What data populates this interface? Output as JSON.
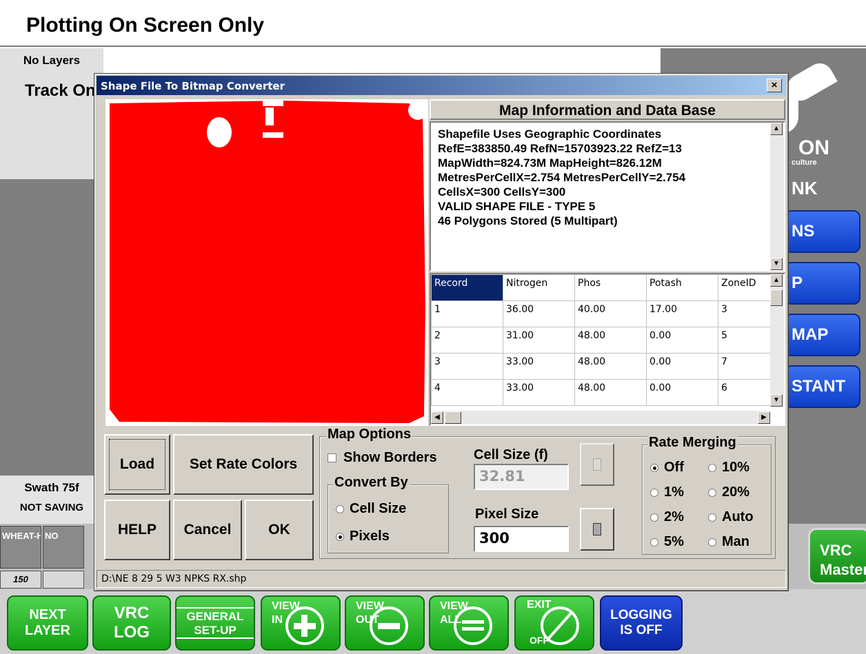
{
  "app": {
    "title": "Plotting On Screen Only",
    "left_panel": {
      "layers": "No Layers",
      "mode": "Track Only"
    },
    "swath": {
      "label": "Swath 75f",
      "saving": "NOT SAVING"
    },
    "logo": {
      "text1": "ON",
      "text2": "culture",
      "text3": "NK"
    },
    "side_buttons": [
      "NS",
      "P",
      "MAP",
      "STANT"
    ],
    "lanes": [
      {
        "label": "WHEAT-HR",
        "value": "150"
      },
      {
        "label": "NO",
        "value": ""
      }
    ],
    "vrc_master": {
      "line1": "VRC",
      "line2": "Master"
    }
  },
  "toolbar": {
    "next_layer": {
      "l1": "NEXT",
      "l2": "LAYER"
    },
    "vrc_log": {
      "l1": "VRC",
      "l2": "LOG"
    },
    "general_setup": {
      "l1": "GENERAL",
      "l2": "SET-UP"
    },
    "view_in": {
      "l1": "VIEW",
      "l2": "IN"
    },
    "view_out": {
      "l1": "VIEW",
      "l2": "OUT"
    },
    "view_all": {
      "l1": "VIEW",
      "l2": "ALL"
    },
    "exit": {
      "l1": "EXIT",
      "l2": "OFF"
    },
    "logging": {
      "l1": "LOGGING",
      "l2": "IS OFF"
    }
  },
  "dialog": {
    "title": "Shape File To Bitmap Converter",
    "close_glyph": "×",
    "map_fill_color": "#ff0000",
    "info_header": "Map Information and Data Base",
    "info_lines": [
      "Shapefile Uses Geographic Coordinates",
      "RefE=383850.49 RefN=15703923.22 RefZ=13",
      "MapWidth=824.73M MapHeight=826.12M",
      "MetresPerCellX=2.754 MetresPerCellY=2.754",
      "CellsX=300 CellsY=300",
      "VALID SHAPE FILE - TYPE 5",
      "46 Polygons Stored (5 Multipart)"
    ],
    "table": {
      "columns": [
        "Record",
        "Nitrogen",
        "Phos",
        "Potash",
        "ZoneID"
      ],
      "rows": [
        [
          "1",
          "36.00",
          "40.00",
          "17.00",
          "3"
        ],
        [
          "2",
          "31.00",
          "48.00",
          "0.00",
          "5"
        ],
        [
          "3",
          "33.00",
          "48.00",
          "0.00",
          "7"
        ],
        [
          "4",
          "33.00",
          "48.00",
          "0.00",
          "6"
        ]
      ]
    },
    "buttons": {
      "load": "Load",
      "set_rate_colors": "Set Rate Colors",
      "help": "HELP",
      "cancel": "Cancel",
      "ok": "OK"
    },
    "map_options": {
      "legend": "Map Options",
      "show_borders": "Show Borders",
      "convert_by": {
        "legend": "Convert By",
        "cell_size": "Cell Size",
        "pixels": "Pixels"
      },
      "cell_size_label": "Cell Size (f)",
      "cell_size_value": "32.81",
      "pixel_size_label": "Pixel Size",
      "pixel_size_value": "300"
    },
    "rate_merging": {
      "legend": "Rate Merging",
      "options": [
        "Off",
        "10%",
        "1%",
        "20%",
        "2%",
        "Auto",
        "5%",
        "Man"
      ],
      "selected": "Off"
    },
    "status": "D:\\NE 8 29 5 W3 NPKS RX.shp"
  }
}
